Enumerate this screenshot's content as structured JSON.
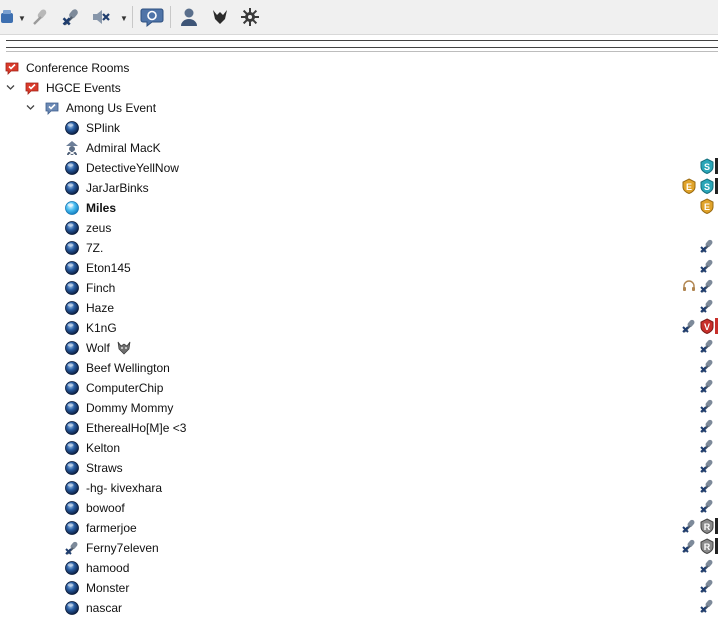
{
  "toolbar": {
    "buttons": [
      {
        "name": "server-icon"
      },
      {
        "name": "microphone-icon"
      },
      {
        "name": "microphone-mute-icon"
      },
      {
        "name": "speaker-mute-icon"
      },
      {
        "name": "chat-icon"
      },
      {
        "name": "user-identity-icon"
      },
      {
        "name": "wolf-icon"
      },
      {
        "name": "settings-gear-icon"
      }
    ]
  },
  "tree": {
    "root": {
      "label": "Conference Rooms"
    },
    "channel": {
      "label": "HGCE Events"
    },
    "subchannel": {
      "label": "Among Us Event"
    },
    "users": [
      {
        "name": "SPlink"
      },
      {
        "name": "Admiral MacK"
      },
      {
        "name": "DetectiveYellNow"
      },
      {
        "name": "JarJarBinks"
      },
      {
        "name": "Miles"
      },
      {
        "name": "zeus"
      },
      {
        "name": "7Z."
      },
      {
        "name": "Eton145"
      },
      {
        "name": "Finch"
      },
      {
        "name": "Haze"
      },
      {
        "name": "K1nG"
      },
      {
        "name": "Wolf"
      },
      {
        "name": "Beef Wellington"
      },
      {
        "name": "ComputerChip"
      },
      {
        "name": "Dommy Mommy"
      },
      {
        "name": "EtherealHo[M]e <3"
      },
      {
        "name": "Kelton"
      },
      {
        "name": "Straws"
      },
      {
        "name": "-hg- kivexhara"
      },
      {
        "name": "bowoof"
      },
      {
        "name": "farmerjoe"
      },
      {
        "name": "Ferny7eleven"
      },
      {
        "name": "hamood"
      },
      {
        "name": "Monster"
      },
      {
        "name": "nascar"
      }
    ]
  },
  "badges": {
    "supporter_letter": "S",
    "event_letter": "E",
    "v_letter": "V",
    "r_letter": "R"
  },
  "colors": {
    "accent_red": "#d93a2b",
    "status_blue": "#1f4f8f",
    "talking_blue": "#3fb6ef",
    "teal_badge": "#2aa6b8",
    "gold_badge": "#e0a32a",
    "red_badge": "#c8302b",
    "gray_badge": "#8a8a8a"
  }
}
